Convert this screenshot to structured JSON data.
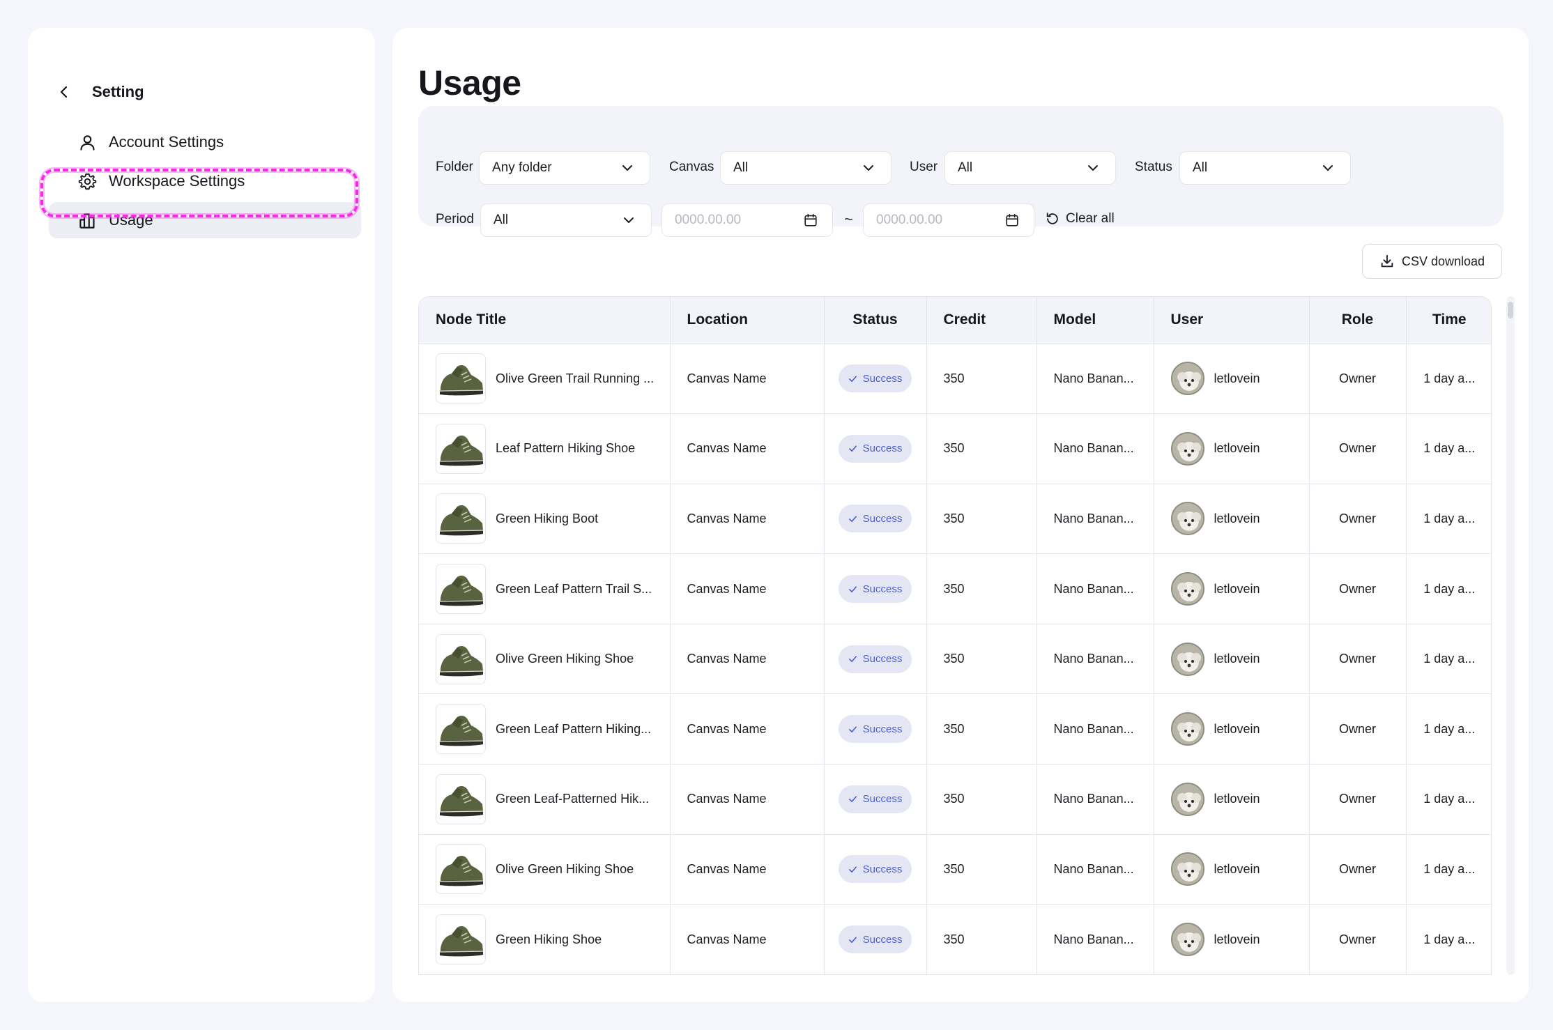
{
  "sidebar": {
    "title": "Setting",
    "items": [
      {
        "label": "Account Settings",
        "icon": "user-icon"
      },
      {
        "label": "Workspace Settings",
        "icon": "gear-icon"
      },
      {
        "label": "Usage",
        "icon": "bar-chart-icon",
        "active": true
      }
    ]
  },
  "main": {
    "title": "Usage",
    "filters": {
      "folder": {
        "label": "Folder",
        "value": "Any folder"
      },
      "canvas": {
        "label": "Canvas",
        "value": "All"
      },
      "user": {
        "label": "User",
        "value": "All"
      },
      "status": {
        "label": "Status",
        "value": "All"
      },
      "period": {
        "label": "Period",
        "value": "All"
      },
      "date_from": {
        "placeholder": "0000.00.00"
      },
      "date_to": {
        "placeholder": "0000.00.00"
      },
      "separator": "~",
      "clear_all": "Clear all"
    },
    "csv_download": "CSV download",
    "table": {
      "columns": [
        "Node Title",
        "Location",
        "Status",
        "Credit",
        "Model",
        "User",
        "Role",
        "Time"
      ],
      "rows": [
        {
          "title": "Olive Green Trail Running ...",
          "location": "Canvas Name",
          "status": "Success",
          "credit": "350",
          "model": "Nano Banan...",
          "user": "letlovein",
          "role": "Owner",
          "time": "1 day a..."
        },
        {
          "title": "Leaf Pattern Hiking Shoe",
          "location": "Canvas Name",
          "status": "Success",
          "credit": "350",
          "model": "Nano Banan...",
          "user": "letlovein",
          "role": "Owner",
          "time": "1 day a..."
        },
        {
          "title": "Green Hiking Boot",
          "location": "Canvas Name",
          "status": "Success",
          "credit": "350",
          "model": "Nano Banan...",
          "user": "letlovein",
          "role": "Owner",
          "time": "1 day a..."
        },
        {
          "title": "Green Leaf Pattern Trail S...",
          "location": "Canvas Name",
          "status": "Success",
          "credit": "350",
          "model": "Nano Banan...",
          "user": "letlovein",
          "role": "Owner",
          "time": "1 day a..."
        },
        {
          "title": "Olive Green Hiking Shoe",
          "location": "Canvas Name",
          "status": "Success",
          "credit": "350",
          "model": "Nano Banan...",
          "user": "letlovein",
          "role": "Owner",
          "time": "1 day a..."
        },
        {
          "title": "Green Leaf Pattern Hiking...",
          "location": "Canvas Name",
          "status": "Success",
          "credit": "350",
          "model": "Nano Banan...",
          "user": "letlovein",
          "role": "Owner",
          "time": "1 day a..."
        },
        {
          "title": "Green Leaf-Patterned Hik...",
          "location": "Canvas Name",
          "status": "Success",
          "credit": "350",
          "model": "Nano Banan...",
          "user": "letlovein",
          "role": "Owner",
          "time": "1 day a..."
        },
        {
          "title": "Olive Green Hiking Shoe",
          "location": "Canvas Name",
          "status": "Success",
          "credit": "350",
          "model": "Nano Banan...",
          "user": "letlovein",
          "role": "Owner",
          "time": "1 day a..."
        },
        {
          "title": "Green Hiking Shoe",
          "location": "Canvas Name",
          "status": "Success",
          "credit": "350",
          "model": "Nano Banan...",
          "user": "letlovein",
          "role": "Owner",
          "time": "1 day a..."
        }
      ]
    }
  },
  "colors": {
    "background": "#f5f6fb",
    "panel": "#ffffff",
    "filter_bg": "#f3f4f9",
    "badge_bg": "#e4e7f3",
    "badge_text": "#4a5fd2",
    "highlight": "#f32de6"
  }
}
